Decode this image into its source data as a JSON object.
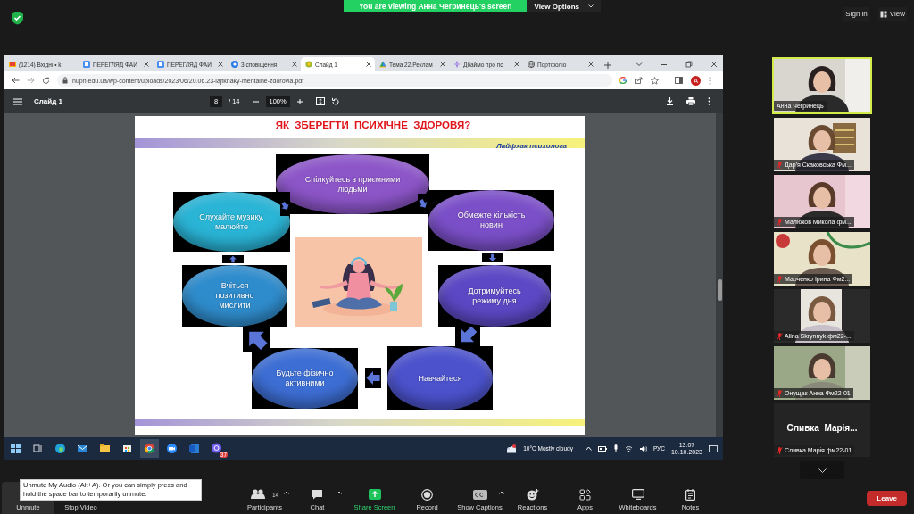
{
  "meeting_bar": {
    "banner": "You are viewing Анна Чегринець's screen",
    "view_options": "View Options",
    "sign_in": "Sign in",
    "view": "View"
  },
  "browser": {
    "tabs": [
      {
        "title": "(1214) Вхідні • k",
        "selected": false,
        "close_button": false
      },
      {
        "title": "ПЕРЕГЛЯД ФАЙ",
        "selected": false,
        "close_button": true
      },
      {
        "title": "ПЕРЕГЛЯД ФАЙ",
        "selected": false,
        "close_button": true
      },
      {
        "title": "3 сповіщення",
        "selected": false,
        "close_button": true
      },
      {
        "title": "Слайд 1",
        "selected": true,
        "close_button": true
      },
      {
        "title": "Тема 22.Реклам",
        "selected": false,
        "close_button": true
      },
      {
        "title": "Дбаймо про пс",
        "selected": false,
        "close_button": true
      },
      {
        "title": "Портфоліо",
        "selected": false,
        "close_button": true
      }
    ],
    "address": "nuph.edu.ua/wp-content/uploads/2023/06/20.06.23-lajfkhaky-mentalne-zdorovia.pdf",
    "profile_initial": "A"
  },
  "pdf_viewer": {
    "title": "Слайд 1",
    "page": "8",
    "page_count": "/ 14",
    "zoom": "100%"
  },
  "slide": {
    "title": "ЯК  ЗБЕРЕГТИ  ПСИХІЧНЕ  ЗДОРОВЯ?",
    "subtitle": "Лайфхак психолога",
    "nodes": [
      {
        "text": "Спілкуйтесь з приємними людьми",
        "color": "#8c55c8"
      },
      {
        "text": "Слухайте музику, малюйте",
        "color": "#2ab4d6"
      },
      {
        "text": "Обмежте кількість новин",
        "color": "#7b4fc8"
      },
      {
        "text": "Вчіться позитивно мислити",
        "color": "#2f8ccc"
      },
      {
        "text": "Дотримуйтесь режиму дня",
        "color": "#5c48c4"
      },
      {
        "text": "Будьте фізично активними",
        "color": "#3d6ed4"
      },
      {
        "text": "Навчайтеся",
        "color": "#4b52cc"
      }
    ]
  },
  "taskbar": {
    "app_badge": "37",
    "weather": "10°C  Mostly cloudy",
    "language": "РУС",
    "time": "13:07",
    "date": "10.10.2023"
  },
  "participants": [
    {
      "name": "Анна Чегринець",
      "kind": "video",
      "muted": false,
      "active": true
    },
    {
      "name": "Дар’я Скаковська Фм...",
      "kind": "video",
      "muted": true,
      "active": false
    },
    {
      "name": "Малюков Микола фм...",
      "kind": "video",
      "muted": true,
      "active": false
    },
    {
      "name": "Марченко Ірина Фм2...",
      "kind": "video",
      "muted": true,
      "active": false
    },
    {
      "name": "Alina Skrynnyk фм22-...",
      "kind": "video",
      "muted": true,
      "active": false
    },
    {
      "name": "Онущак Анна Фм22-01",
      "kind": "video",
      "muted": true,
      "active": false
    },
    {
      "name": "Сливка Марія фм22-01",
      "display_name": "Сливка  Марія...",
      "kind": "no_video",
      "muted": true,
      "active": false
    }
  ],
  "toolbar": {
    "items": [
      {
        "label": "Unmute",
        "kind": "audio",
        "hovered": true
      },
      {
        "label": "Stop Video",
        "kind": "video",
        "hovered": false
      },
      {
        "label": "Participants",
        "kind": "participants",
        "count": "14",
        "hovered": false
      },
      {
        "label": "Chat",
        "kind": "chat",
        "hovered": false
      },
      {
        "label": "Share Screen",
        "kind": "share",
        "hovered": false
      },
      {
        "label": "Record",
        "kind": "record",
        "hovered": false
      },
      {
        "label": "Show Captions",
        "kind": "captions",
        "hovered": false
      },
      {
        "label": "Reactions",
        "kind": "reactions",
        "hovered": false
      },
      {
        "label": "Apps",
        "kind": "apps",
        "hovered": false
      },
      {
        "label": "Whiteboards",
        "kind": "whiteboards",
        "hovered": false
      },
      {
        "label": "Notes",
        "kind": "notes",
        "hovered": false
      }
    ],
    "leave": "Leave"
  },
  "tooltip": "Unmute My Audio (Alt+A). Or you can simply press and hold the space bar to temporarily unmute."
}
